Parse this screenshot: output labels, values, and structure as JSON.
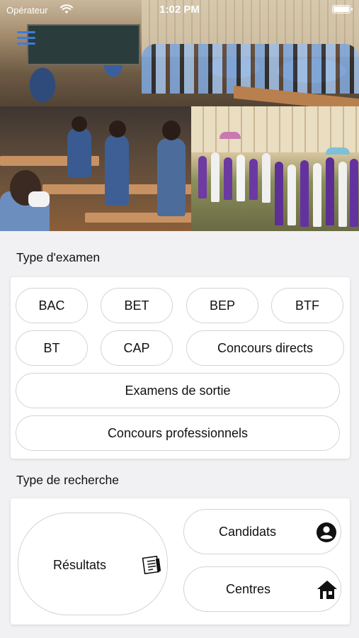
{
  "status_bar": {
    "carrier": "Opérateur",
    "time": "1:02 PM"
  },
  "hero": {
    "menu_icon": "hamburger-icon"
  },
  "exam_type": {
    "title": "Type d'examen",
    "options": [
      "BAC",
      "BET",
      "BEP",
      "BTF",
      "BT",
      "CAP",
      "Concours directs",
      "Examens de sortie",
      "Concours professionnels"
    ]
  },
  "search_type": {
    "title": "Type de recherche",
    "results_label": "Résultats",
    "results_icon": "document-list-icon",
    "candidates_label": "Candidats",
    "candidates_icon": "user-circle-icon",
    "centres_label": "Centres",
    "centres_icon": "house-icon"
  },
  "colors": {
    "accent": "#3c7be4",
    "background": "#f1f1f3",
    "card": "#ffffff",
    "border": "#d4d4d4"
  }
}
